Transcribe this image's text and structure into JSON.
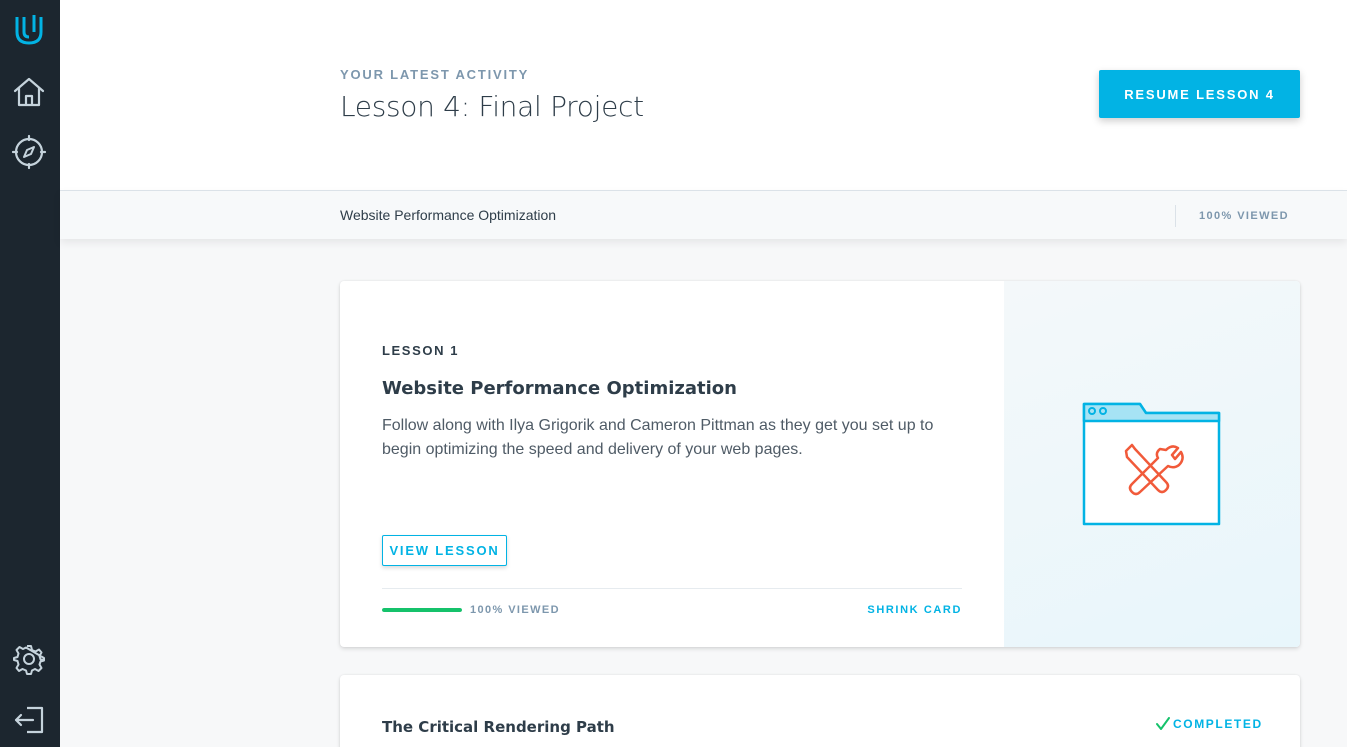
{
  "sidebar": {
    "items": [
      {
        "name": "udacity-logo-icon"
      },
      {
        "name": "home-icon"
      },
      {
        "name": "compass-icon"
      },
      {
        "name": "gear-icon"
      },
      {
        "name": "logout-icon"
      }
    ],
    "accent": "#02b3e4"
  },
  "header": {
    "eyebrow": "YOUR LATEST ACTIVITY",
    "title": "Lesson 4: Final Project",
    "resume_label": "RESUME LESSON 4"
  },
  "course_bar": {
    "course_name": "Website Performance Optimization",
    "viewed": "100% VIEWED"
  },
  "lesson_card": {
    "number": "LESSON 1",
    "title": "Website Performance Optimization",
    "description": "Follow along with Ilya Grigorik and Cameron Pittman as they get you set up to begin optimizing the speed and delivery of your web pages.",
    "view_label": "VIEW LESSON",
    "progress": 1.0,
    "progress_label": "100% VIEWED",
    "shrink_label": "SHRINK CARD",
    "icon": "tools-window-icon",
    "progress_color": "#15c26b"
  },
  "next_card": {
    "title": "The Critical Rendering Path",
    "status": "COMPLETED",
    "status_icon": "checkmark-icon"
  }
}
